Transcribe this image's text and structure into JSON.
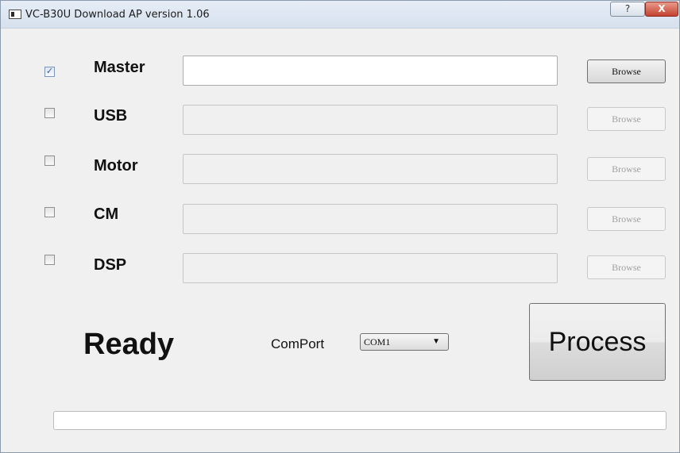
{
  "window": {
    "title": "VC-B30U Download AP version 1.06",
    "help_label": "?",
    "close_label": "X",
    "app_icon": "app-window-icon"
  },
  "rows": [
    {
      "label": "Master",
      "checked": true,
      "checkbox_mark": "✓",
      "path_value": "",
      "browse_label": "Browse",
      "browse_enabled": true
    },
    {
      "label": "USB",
      "checked": false,
      "checkbox_mark": "",
      "path_value": "",
      "browse_label": "Browse",
      "browse_enabled": false
    },
    {
      "label": "Motor",
      "checked": false,
      "checkbox_mark": "",
      "path_value": "",
      "browse_label": "Browse",
      "browse_enabled": false
    },
    {
      "label": "CM",
      "checked": false,
      "checkbox_mark": "",
      "path_value": "",
      "browse_label": "Browse",
      "browse_enabled": false
    },
    {
      "label": "DSP",
      "checked": false,
      "checkbox_mark": "",
      "path_value": "",
      "browse_label": "Browse",
      "browse_enabled": false
    }
  ],
  "status_text": "Ready",
  "comport": {
    "label": "ComPort",
    "selected": "COM1",
    "arrow": "▼"
  },
  "process_label": "Process",
  "progress": {
    "value": 0
  },
  "colors": {
    "progress_fill": "#06b025",
    "close_button": "#c54232"
  }
}
